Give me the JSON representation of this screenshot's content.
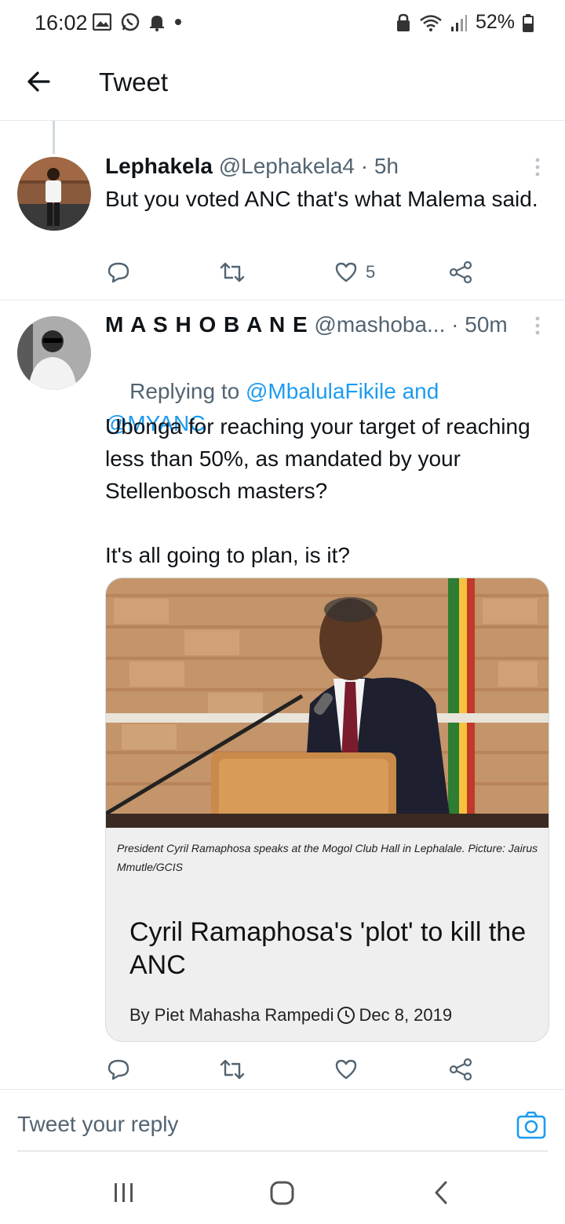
{
  "status_bar": {
    "time": "16:02",
    "battery": "52%",
    "icons_left": [
      "image-icon",
      "whatsapp-icon",
      "notification-bell-icon",
      "dot-icon"
    ],
    "icons_right": [
      "lock-icon",
      "wifi-icon",
      "signal-icon",
      "battery-icon"
    ]
  },
  "header": {
    "title": "Tweet"
  },
  "tweets": [
    {
      "display_name": "Lephakela",
      "handle": "@Lephakela4",
      "time": "· 5h",
      "text": "But you voted ANC that's what Malema said.",
      "likes": "5"
    },
    {
      "display_name": "M A S H O B A N E",
      "handle": "@mashoba...",
      "time": "· 50m",
      "replying_prefix": "Replying to ",
      "reply_mention_1": "@MbalulaFikile",
      "reply_and": " and",
      "reply_mention_2": "@MYANC",
      "text": "Ubonga for reaching your target of reaching less than 50%, as mandated by your Stellenbosch masters?\n\nIt's all going to plan, is it?",
      "card": {
        "caption": "President Cyril Ramaphosa speaks at the Mogol Club Hall in Lephalale. Picture: Jairus Mmutle/GCIS",
        "headline": "Cyril Ramaphosa's 'plot' to kill the ANC",
        "byline": "By Piet Mahasha Rampedi",
        "date": "Dec 8, 2019"
      }
    }
  ],
  "reply_bar": {
    "placeholder": "Tweet your reply"
  },
  "colors": {
    "accent": "#1d9bf0",
    "text": "#0f1419",
    "muted": "#536471"
  }
}
